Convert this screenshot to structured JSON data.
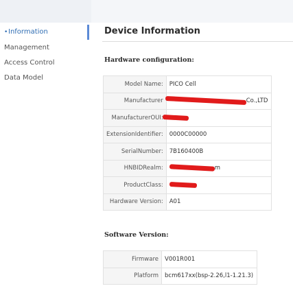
{
  "sidebar": {
    "items": [
      {
        "label": "Information",
        "active": true
      },
      {
        "label": "Management"
      },
      {
        "label": "Access Control"
      },
      {
        "label": "Data Model"
      }
    ]
  },
  "main": {
    "title": "Device Information",
    "hardware": {
      "heading": "Hardware configuration:",
      "rows": [
        {
          "key": "Model Name:",
          "value": "PICO Cell"
        },
        {
          "key": "Manufacturer",
          "value": "Co.,LTD",
          "redacted": true
        },
        {
          "key": "ManufacturerOUI:",
          "value": "",
          "redacted": true
        },
        {
          "key": "ExtensionIdentifier:",
          "value": "0000C00000"
        },
        {
          "key": "SerialNumber:",
          "value": "7B160400B"
        },
        {
          "key": "HNBIDRealm:",
          "value": "m",
          "redacted": true
        },
        {
          "key": "ProductClass:",
          "value": "",
          "redacted": true
        },
        {
          "key": "Hardware Version:",
          "value": "A01"
        }
      ]
    },
    "software": {
      "heading": "Software Version:",
      "rows": [
        {
          "key": "Firmware",
          "value": "V001R001"
        },
        {
          "key": "Platform",
          "value": "bcm617xx(bsp-2.26,l1-1.21.3)"
        }
      ]
    }
  },
  "colors": {
    "accent": "#2f6db3",
    "redaction": "#e11b1b",
    "key_cell_bg": "#f5f5f5"
  }
}
